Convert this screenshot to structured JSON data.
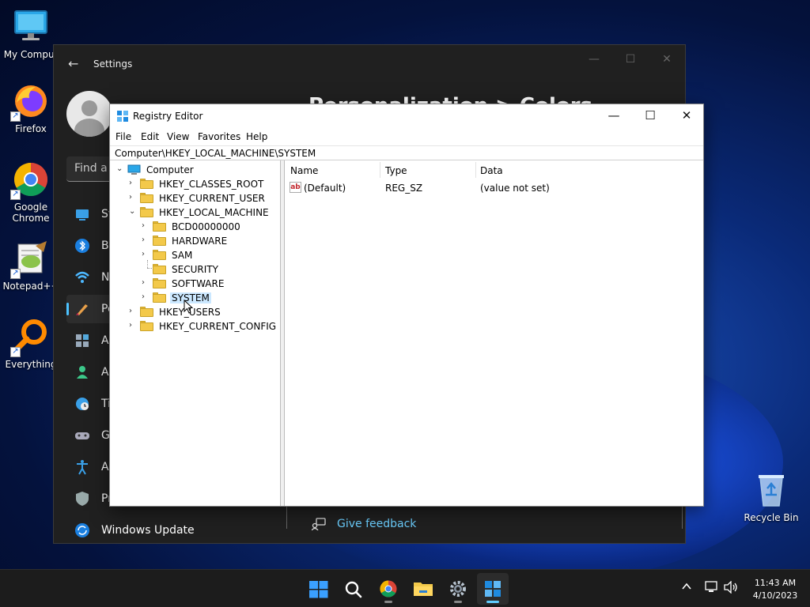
{
  "desktop": {
    "icons": [
      {
        "label": "My Comput",
        "icon": "monitor-icon"
      },
      {
        "label": "Firefox",
        "icon": "firefox-icon"
      },
      {
        "label": "Google Chrome",
        "icon": "chrome-icon"
      },
      {
        "label": "Notepad++",
        "icon": "notepadpp-icon"
      },
      {
        "label": "Everything",
        "icon": "everything-icon"
      },
      {
        "label": "Recycle Bin",
        "icon": "recycle-bin-icon"
      }
    ]
  },
  "settings": {
    "title": "Settings",
    "heading": "Personalization  >  Colors",
    "search_placeholder": "Find a s",
    "nav": [
      {
        "label": "Sy",
        "icon": "system-icon"
      },
      {
        "label": "Bl",
        "icon": "bluetooth-icon"
      },
      {
        "label": "N",
        "icon": "network-icon"
      },
      {
        "label": "Pe",
        "icon": "personalization-icon",
        "active": true
      },
      {
        "label": "A",
        "icon": "apps-icon"
      },
      {
        "label": "A",
        "icon": "accounts-icon"
      },
      {
        "label": "Ti",
        "icon": "time-icon"
      },
      {
        "label": "G",
        "icon": "gaming-icon"
      },
      {
        "label": "A",
        "icon": "accessibility-icon"
      },
      {
        "label": "Pr",
        "icon": "privacy-icon"
      },
      {
        "label": "Windows Update",
        "icon": "windows-update-icon"
      }
    ],
    "feedback": "Give feedback",
    "colors": {
      "accent": "#4cc2ff",
      "bg": "#202020"
    }
  },
  "regedit": {
    "title": "Registry Editor",
    "menu": [
      "File",
      "Edit",
      "View",
      "Favorites",
      "Help"
    ],
    "address": "Computer\\HKEY_LOCAL_MACHINE\\SYSTEM",
    "tree": [
      {
        "name": "Computer",
        "level": 0,
        "state": "expanded",
        "icon": "computer"
      },
      {
        "name": "HKEY_CLASSES_ROOT",
        "level": 1,
        "state": "collapsed"
      },
      {
        "name": "HKEY_CURRENT_USER",
        "level": 1,
        "state": "collapsed"
      },
      {
        "name": "HKEY_LOCAL_MACHINE",
        "level": 1,
        "state": "expanded"
      },
      {
        "name": "BCD00000000",
        "level": 2,
        "state": "collapsed"
      },
      {
        "name": "HARDWARE",
        "level": 2,
        "state": "collapsed"
      },
      {
        "name": "SAM",
        "level": 2,
        "state": "collapsed"
      },
      {
        "name": "SECURITY",
        "level": 2,
        "state": "leaf"
      },
      {
        "name": "SOFTWARE",
        "level": 2,
        "state": "collapsed"
      },
      {
        "name": "SYSTEM",
        "level": 2,
        "state": "collapsed",
        "selected": true
      },
      {
        "name": "HKEY_USERS",
        "level": 1,
        "state": "collapsed"
      },
      {
        "name": "HKEY_CURRENT_CONFIG",
        "level": 1,
        "state": "collapsed"
      }
    ],
    "columns": [
      "Name",
      "Type",
      "Data"
    ],
    "values": [
      {
        "name": "(Default)",
        "type": "REG_SZ",
        "data": "(value not set)"
      }
    ],
    "colors": {
      "selection": "#cce8ff",
      "folder": "#f3c94a"
    }
  },
  "taskbar": {
    "apps": [
      {
        "name": "start",
        "icon": "windows-start-icon"
      },
      {
        "name": "search",
        "icon": "search-icon"
      },
      {
        "name": "chrome",
        "icon": "chrome-icon"
      },
      {
        "name": "file-explorer",
        "icon": "folder-icon"
      },
      {
        "name": "settings",
        "icon": "gear-icon"
      },
      {
        "name": "registry-editor",
        "icon": "regedit-icon",
        "active": true
      }
    ],
    "time": "11:43 AM",
    "date": "4/10/2023",
    "colors": {
      "active_indicator": "#60cdff"
    }
  }
}
